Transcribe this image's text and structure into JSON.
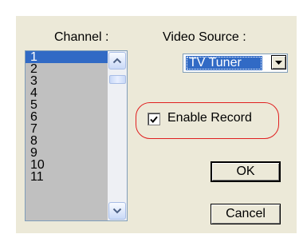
{
  "channel_label": "Channel :",
  "channels": [
    "1",
    "2",
    "3",
    "4",
    "5",
    "6",
    "7",
    "8",
    "9",
    "10",
    "11"
  ],
  "selected_channel": "1",
  "video_source_label": "Video Source :",
  "video_source_value": "TV Tuner",
  "enable_record_label": "Enable Record",
  "enable_record_checked": true,
  "ok_label": "OK",
  "cancel_label": "Cancel",
  "colors": {
    "panel": "#ece9d8",
    "selection": "#316ac5",
    "list_background": "#c0c0c0",
    "highlight_ring": "#e02020"
  }
}
